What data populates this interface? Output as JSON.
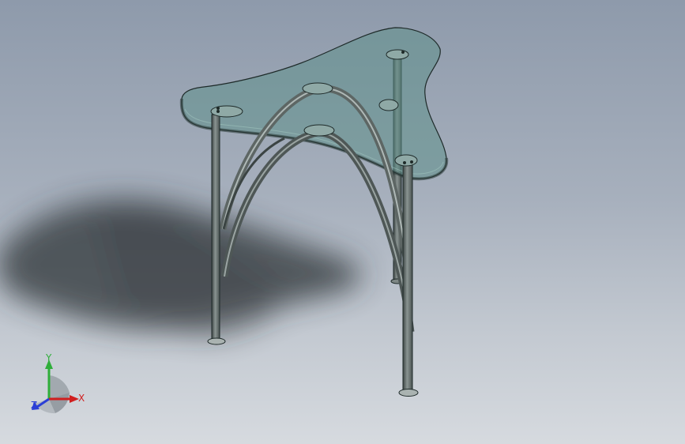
{
  "viewport": {
    "background_top": "#8e9aab",
    "background_bottom": "#d6dadf"
  },
  "model": {
    "glass_color": "#5f8f8a",
    "metal_color": "#6e7775",
    "outline_color": "#1e2a29"
  },
  "triad": {
    "x_label": "X",
    "y_label": "Y",
    "z_label": "Z",
    "x_color": "#d01f1f",
    "y_color": "#2fae3a",
    "z_color": "#2b3fd6"
  }
}
